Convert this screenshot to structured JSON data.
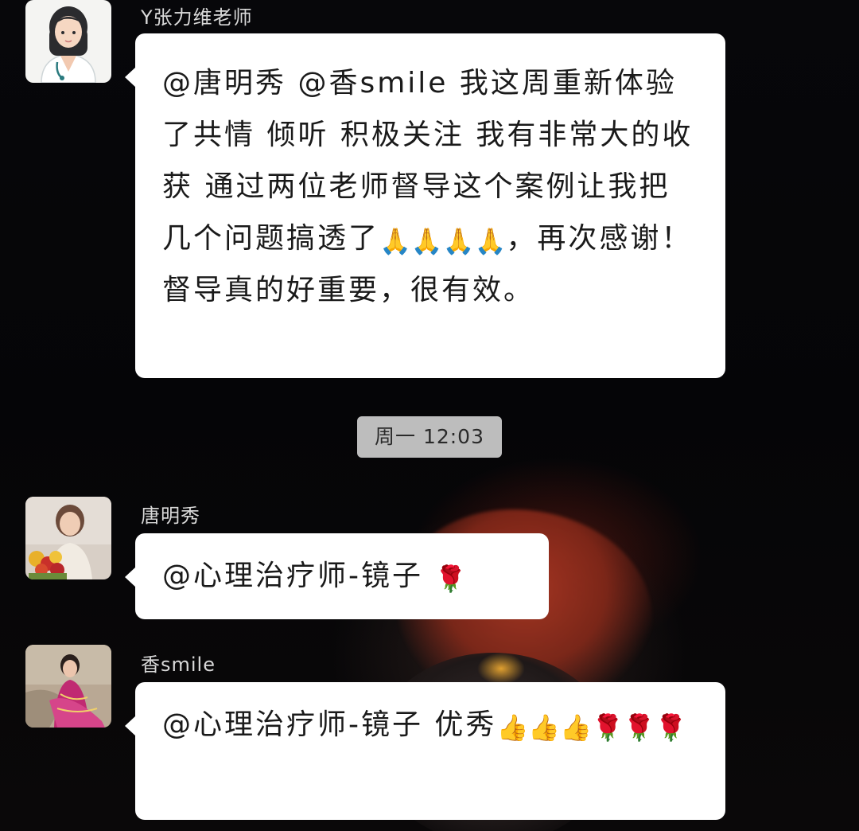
{
  "messages": [
    {
      "sender": "Y张力维老师",
      "text_1": "@唐明秀 @香smile 我这周重新体验了共情 倾听 积极关注 我有非常大的收获 通过两位老师督导这个案例让我把几个问题搞透了",
      "emoji_1": "🙏🙏🙏🙏",
      "text_2": "，再次感谢！督导真的好重要，很有效。"
    },
    {
      "sender": "唐明秀",
      "text_1": "@心理治疗师-镜子 ",
      "emoji_1": "🌹"
    },
    {
      "sender": "香smile",
      "text_1": "@心理治疗师-镜子 优秀",
      "emoji_1": "👍👍👍🌹🌹🌹"
    }
  ],
  "timestamp": "周一 12:03",
  "icons": {
    "avatar_1": "doctor-avatar-icon",
    "avatar_2": "woman-with-flowers-avatar",
    "avatar_3": "woman-with-scarf-avatar"
  },
  "colors": {
    "background": "#050507",
    "bubble": "#ffffff",
    "timestamp_pill": "#bdbdbd",
    "sender_text": "#d9d9d9"
  }
}
